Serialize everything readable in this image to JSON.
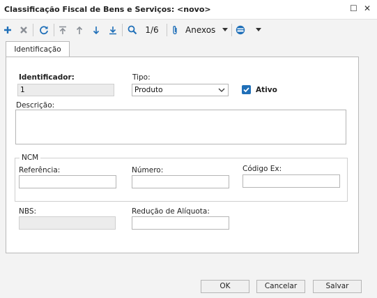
{
  "window": {
    "title": "Classificação Fiscal de Bens e Serviços: <novo>",
    "maximize_glyph": "☐",
    "close_glyph": "✕"
  },
  "toolbar": {
    "record_position": "1/6",
    "anexos_label": "Anexos",
    "icons": [
      "plus-icon",
      "delete-icon",
      "refresh-icon",
      "first-icon",
      "previous-icon",
      "next-icon",
      "last-icon",
      "search-icon",
      "paperclip-icon",
      "chevron-down-icon",
      "card-icon",
      "chevron-down-icon"
    ],
    "accent_color": "#1f6fb8"
  },
  "tabs": [
    {
      "label": "Identificação"
    }
  ],
  "form": {
    "identificador": {
      "label": "Identificador:",
      "value": "1"
    },
    "tipo": {
      "label": "Tipo:",
      "value": "Produto"
    },
    "ativo": {
      "label": "Ativo",
      "checked": true
    },
    "descricao": {
      "label": "Descrição:",
      "value": ""
    },
    "ncm": {
      "group_label": "NCM",
      "referencia": {
        "label": "Referência:",
        "value": ""
      },
      "numero": {
        "label": "Número:",
        "value": ""
      },
      "codigo_ex": {
        "label": "Código Ex:",
        "value": ""
      }
    },
    "nbs": {
      "label": "NBS:",
      "value": ""
    },
    "reducao_aliquota": {
      "label": "Redução de Alíquota:",
      "value": ""
    }
  },
  "buttons": {
    "ok": "OK",
    "cancel": "Cancelar",
    "save": "Salvar"
  }
}
